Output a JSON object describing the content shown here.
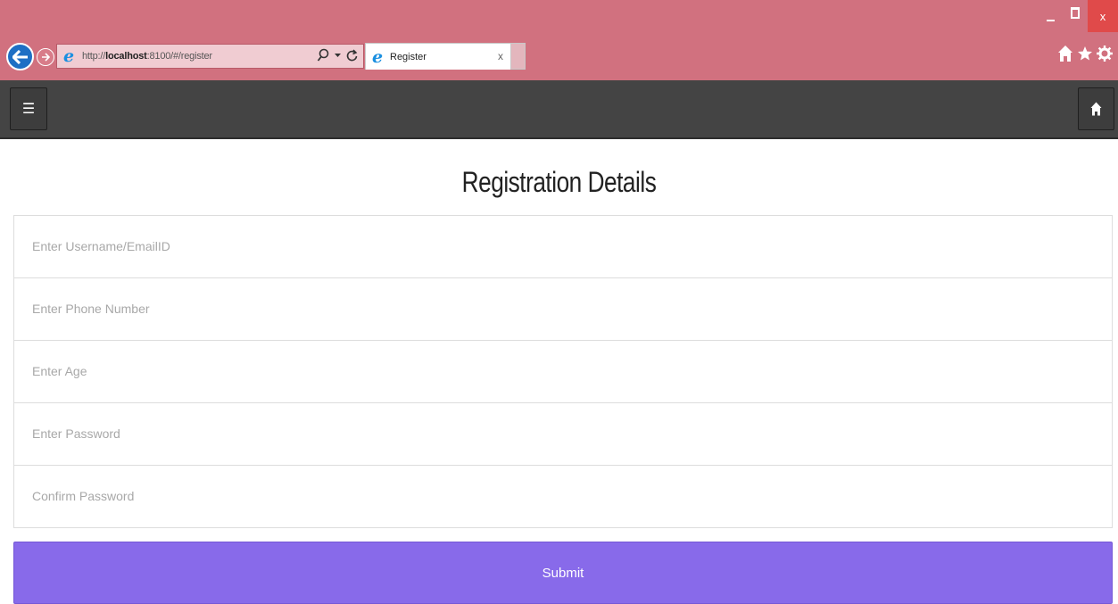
{
  "browser": {
    "window_controls": {
      "close_label": "x"
    },
    "address": {
      "prefix": "http://",
      "host": "localhost",
      "path": ":8100/#/register"
    },
    "tab": {
      "title": "Register",
      "close_label": "x"
    },
    "colors": {
      "chrome": "#d1717f",
      "back_button": "#1e6fc4",
      "close_button": "#e04a4a"
    },
    "icons": [
      "back-arrow-icon",
      "forward-arrow-icon",
      "ie-logo-icon",
      "search-icon",
      "refresh-icon",
      "home-icon",
      "star-icon",
      "gear-icon"
    ]
  },
  "header": {
    "menu_icon": "☰",
    "colors": {
      "bar": "#444444"
    }
  },
  "main": {
    "title": "Registration Details",
    "fields": [
      {
        "name": "username",
        "placeholder": "Enter Username/EmailID",
        "value": ""
      },
      {
        "name": "phone",
        "placeholder": "Enter Phone Number",
        "value": ""
      },
      {
        "name": "age",
        "placeholder": "Enter Age",
        "value": ""
      },
      {
        "name": "password",
        "placeholder": "Enter Password",
        "value": ""
      },
      {
        "name": "confirm_password",
        "placeholder": "Confirm Password",
        "value": ""
      }
    ],
    "submit_label": "Submit",
    "colors": {
      "submit_button": "#886aea"
    }
  }
}
